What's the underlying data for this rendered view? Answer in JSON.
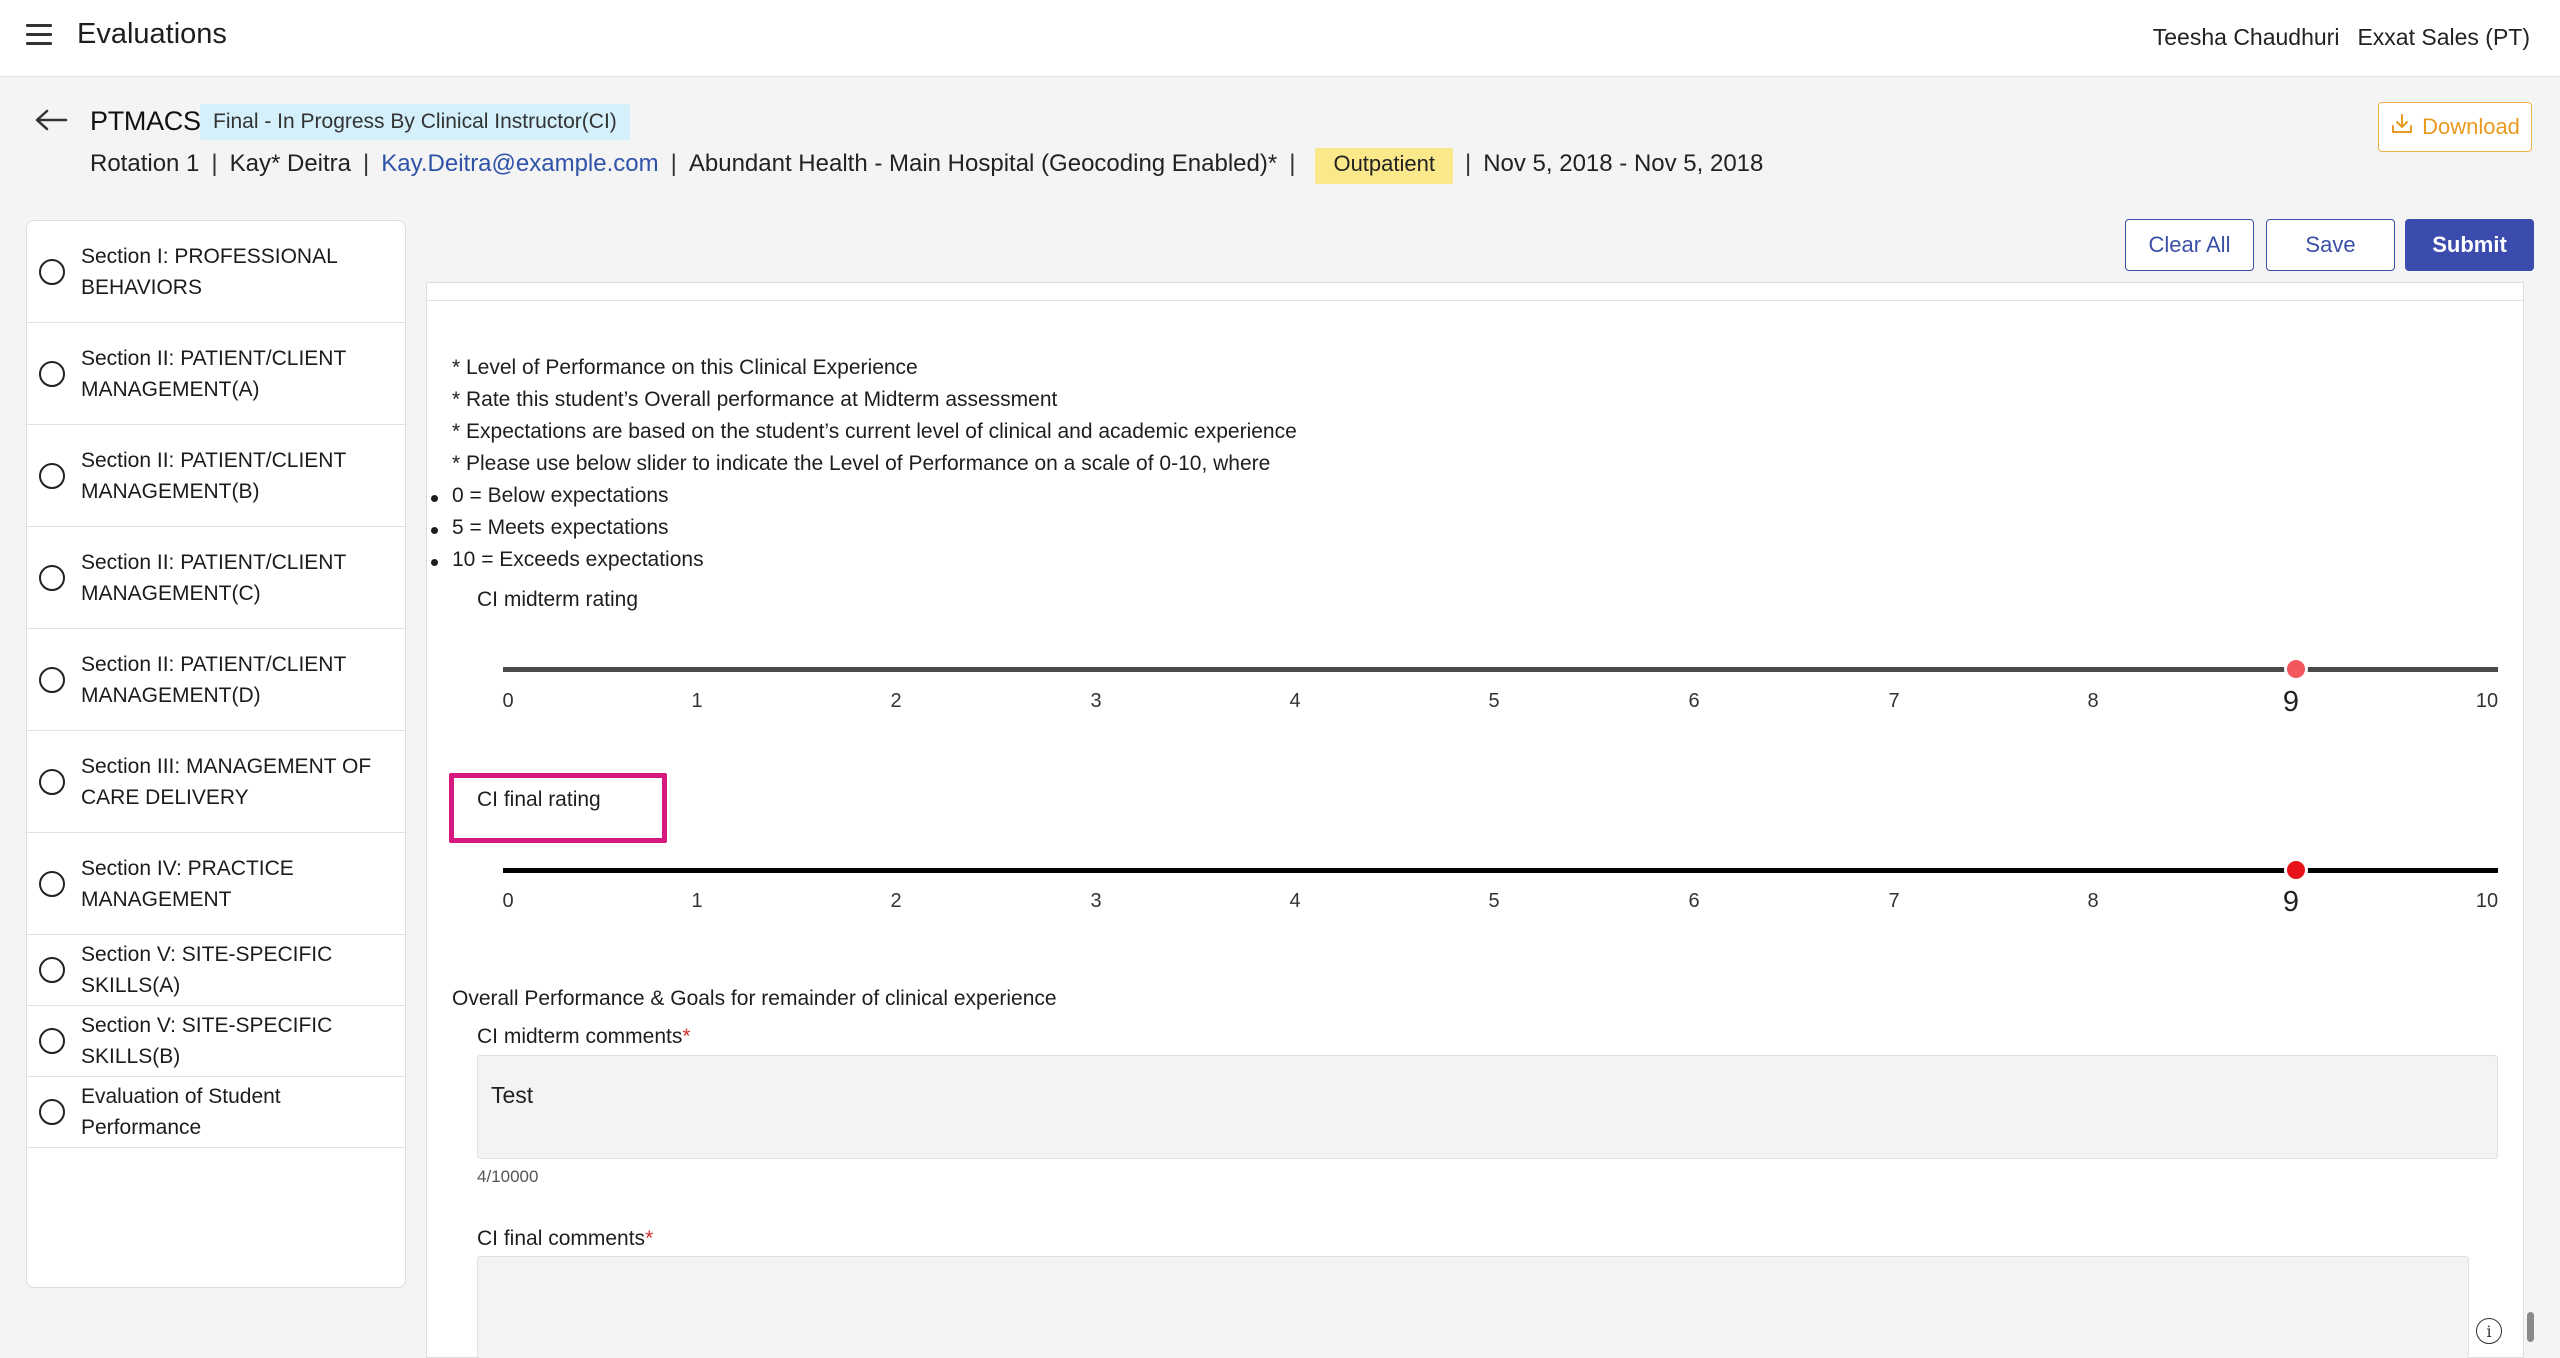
{
  "app": {
    "title": "Evaluations",
    "user_name": "Teesha Chaudhuri",
    "org": "Exxat Sales (PT)"
  },
  "header": {
    "code": "PTMACS",
    "status": "Final - In Progress By Clinical Instructor(CI)",
    "rotation": "Rotation 1",
    "student": "Kay* Deitra",
    "email": "Kay.Deitra@example.com",
    "site": "Abundant Health - Main Hospital (Geocoding Enabled)*",
    "setting": "Outpatient",
    "dates": "Nov 5, 2018 - Nov 5, 2018",
    "download_label": "Download"
  },
  "sidebar": {
    "items": [
      {
        "label": "Section I: PROFESSIONAL BEHAVIORS"
      },
      {
        "label": "Section II: PATIENT/CLIENT MANAGEMENT(A)"
      },
      {
        "label": "Section II: PATIENT/CLIENT MANAGEMENT(B)"
      },
      {
        "label": "Section II: PATIENT/CLIENT MANAGEMENT(C)"
      },
      {
        "label": "Section II: PATIENT/CLIENT MANAGEMENT(D)"
      },
      {
        "label": "Section III: MANAGEMENT OF CARE DELIVERY"
      },
      {
        "label": "Section IV: PRACTICE MANAGEMENT"
      },
      {
        "label": "Section V: SITE-SPECIFIC SKILLS(A)"
      },
      {
        "label": "Section V: SITE-SPECIFIC SKILLS(B)"
      },
      {
        "label": "Evaluation of Student Performance"
      }
    ]
  },
  "actions": {
    "clear": "Clear All",
    "save": "Save",
    "submit": "Submit"
  },
  "instructions": {
    "lines": [
      "* Level of Performance on this Clinical Experience",
      "* Rate this student’s Overall performance at Midterm assessment",
      "* Expectations are based on the student’s current level of clinical and academic experience",
      "* Please use below slider to indicate the Level of Performance on a scale of 0-10, where"
    ],
    "bullets": [
      "0 = Below expectations",
      "5 = Meets expectations",
      "10 = Exceeds expectations"
    ]
  },
  "ratings": {
    "ticks": [
      "0",
      "1",
      "2",
      "3",
      "4",
      "5",
      "6",
      "7",
      "8",
      "9",
      "10"
    ],
    "midterm": {
      "label": "CI midterm rating",
      "value": 9,
      "max": 10,
      "track_color": "#4a4a4a",
      "thumb_color": "#f0585e"
    },
    "final": {
      "label": "CI final rating",
      "value": 9,
      "max": 10,
      "track_color": "#000000",
      "thumb_color": "#e8121b"
    }
  },
  "comments": {
    "section_title": "Overall Performance & Goals for remainder of clinical experience",
    "midterm": {
      "label": "CI midterm comments",
      "required_mark": "*",
      "value": "Test",
      "char_count": "4/10000"
    },
    "final": {
      "label": "CI final comments",
      "required_mark": "*",
      "value": ""
    }
  },
  "colors": {
    "accent": "#3b4bae",
    "download": "#e99a20",
    "highlight": "#d6197f",
    "status_bg": "#d3f0fb",
    "tag_bg": "#fbe88a"
  }
}
